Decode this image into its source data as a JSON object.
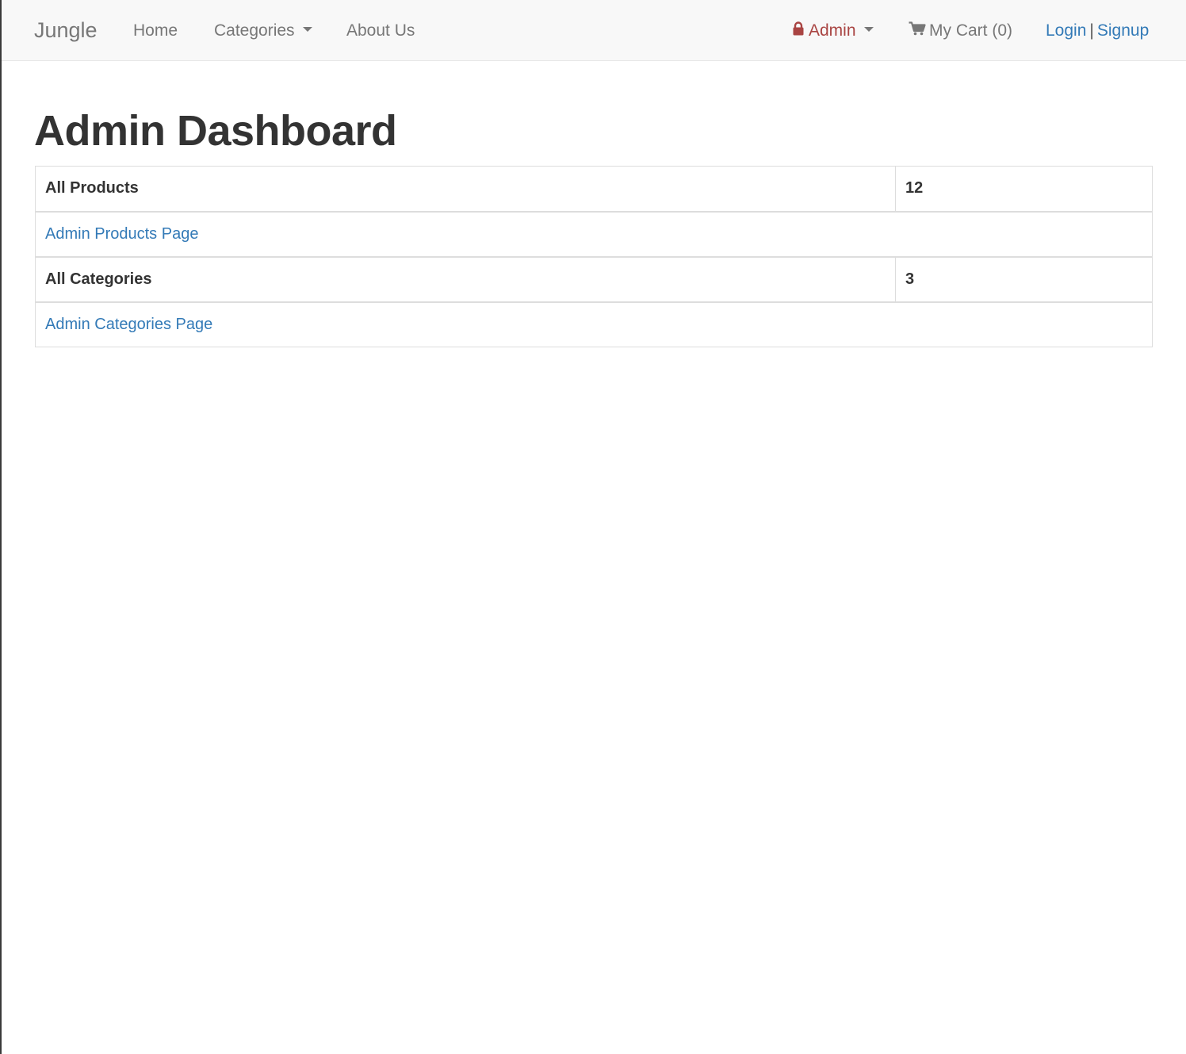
{
  "navbar": {
    "brand": "Jungle",
    "home_label": "Home",
    "categories_label": "Categories",
    "about_label": "About Us",
    "admin_label": "Admin",
    "cart_label": "My Cart (0)",
    "login_label": "Login",
    "separator": "|",
    "signup_label": "Signup",
    "icons": {
      "admin": "lock-icon",
      "cart": "shopping-cart-icon",
      "dropdown": "caret-down-icon"
    }
  },
  "main": {
    "title": "Admin Dashboard",
    "rows": [
      {
        "label": "All Products",
        "value": "12"
      },
      {
        "link": "Admin Products Page"
      },
      {
        "label": "All Categories",
        "value": "3"
      },
      {
        "link": "Admin Categories Page"
      }
    ]
  },
  "colors": {
    "navbar_bg": "#f8f8f8",
    "nav_text": "#777777",
    "admin_red": "#a94442",
    "link_blue": "#337ab7",
    "border": "#dddddd"
  }
}
